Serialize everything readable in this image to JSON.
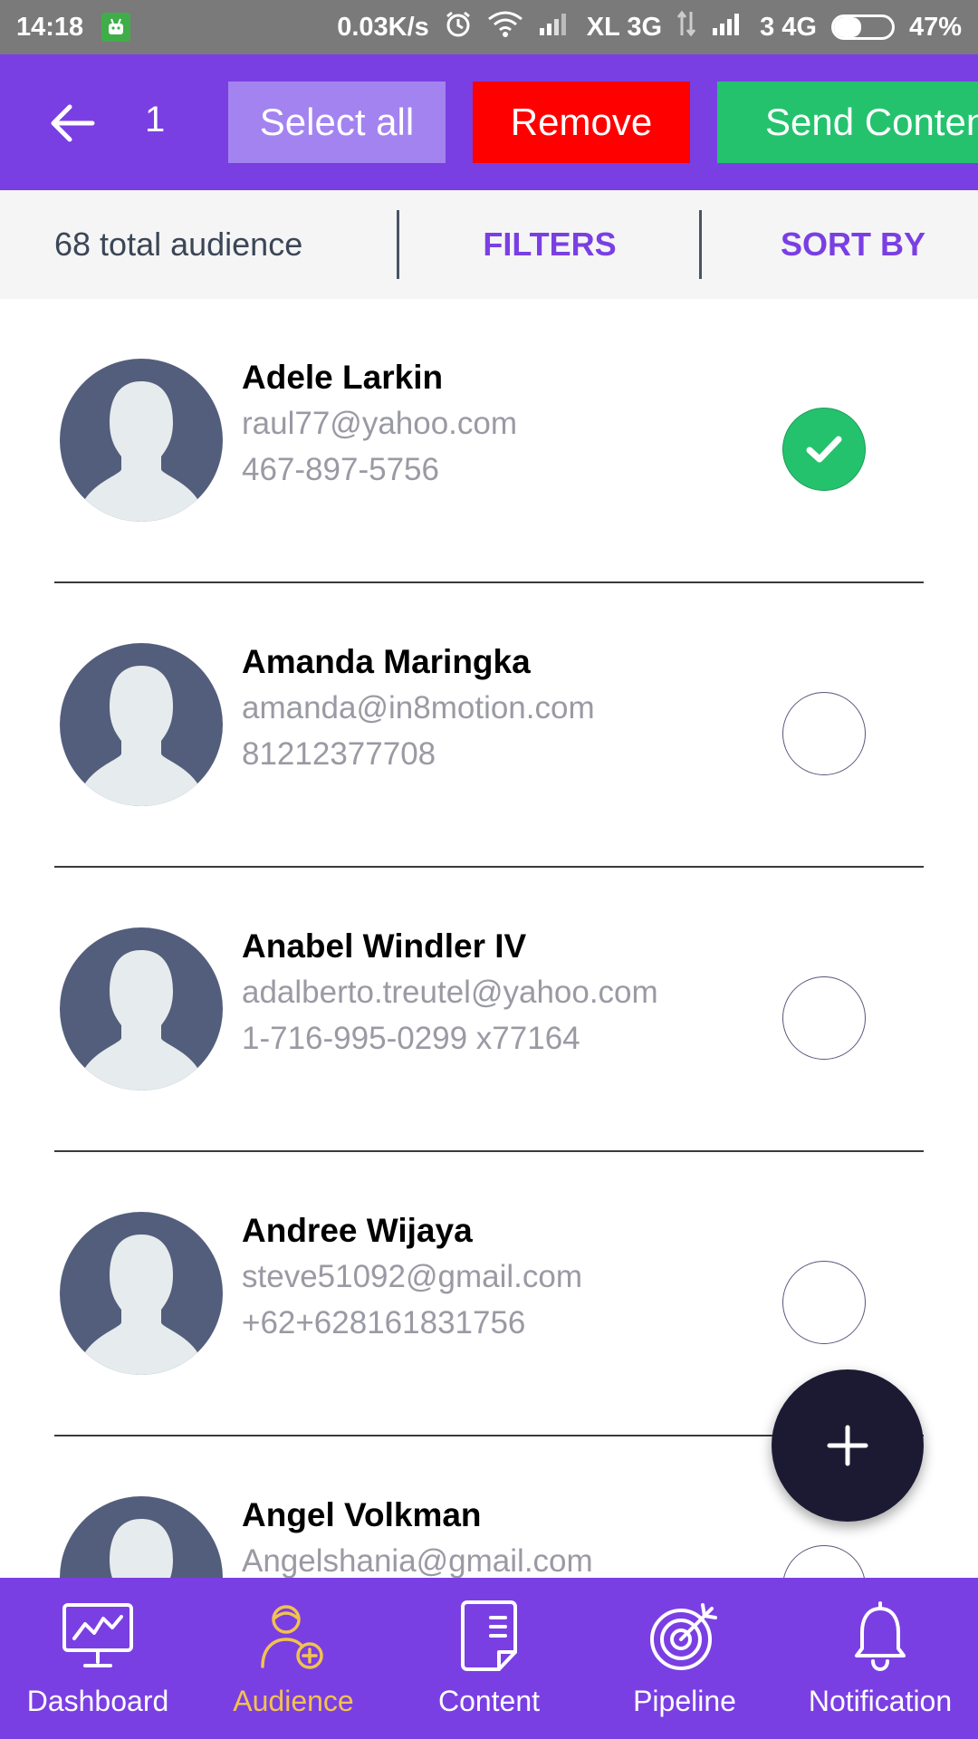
{
  "status_bar": {
    "time": "14:18",
    "net_speed": "0.03K/s",
    "carrier1": "XL 3G",
    "carrier2": "3 4G",
    "battery_text": "47%",
    "battery_level": 0.47
  },
  "app_bar": {
    "selected_count": "1",
    "select_all_label": "Select all",
    "remove_label": "Remove",
    "send_content_label": "Send Content"
  },
  "filter_bar": {
    "total_audience": "68 total audience",
    "filters_label": "FILTERS",
    "sort_by_label": "SORT BY"
  },
  "contacts": [
    {
      "name": "Adele Larkin",
      "email": "raul77@yahoo.com",
      "phone": "467-897-5756",
      "selected": true
    },
    {
      "name": "Amanda Maringka",
      "email": "amanda@in8motion.com",
      "phone": "81212377708",
      "selected": false
    },
    {
      "name": "Anabel Windler IV",
      "email": "adalberto.treutel@yahoo.com",
      "phone": "1-716-995-0299 x77164",
      "selected": false
    },
    {
      "name": "Andree Wijaya",
      "email": "steve51092@gmail.com",
      "phone": "+62+628161831756",
      "selected": false
    },
    {
      "name": "Angel Volkman",
      "email": "Angelshania@gmail.com",
      "phone": "",
      "selected": false
    }
  ],
  "bottom_nav": {
    "items": [
      {
        "label": "Dashboard",
        "icon": "monitor-chart-icon",
        "active": false
      },
      {
        "label": "Audience",
        "icon": "person-add-icon",
        "active": true
      },
      {
        "label": "Content",
        "icon": "document-icon",
        "active": false
      },
      {
        "label": "Pipeline",
        "icon": "target-icon",
        "active": false
      },
      {
        "label": "Notification",
        "icon": "bell-icon",
        "active": false
      }
    ]
  },
  "colors": {
    "primary": "#7a3fe3",
    "select_all_bg": "#a383ef",
    "remove_bg": "#ff0000",
    "send_bg": "#25c26e",
    "active_nav": "#f2c24e",
    "fab": "#1c1a33"
  }
}
